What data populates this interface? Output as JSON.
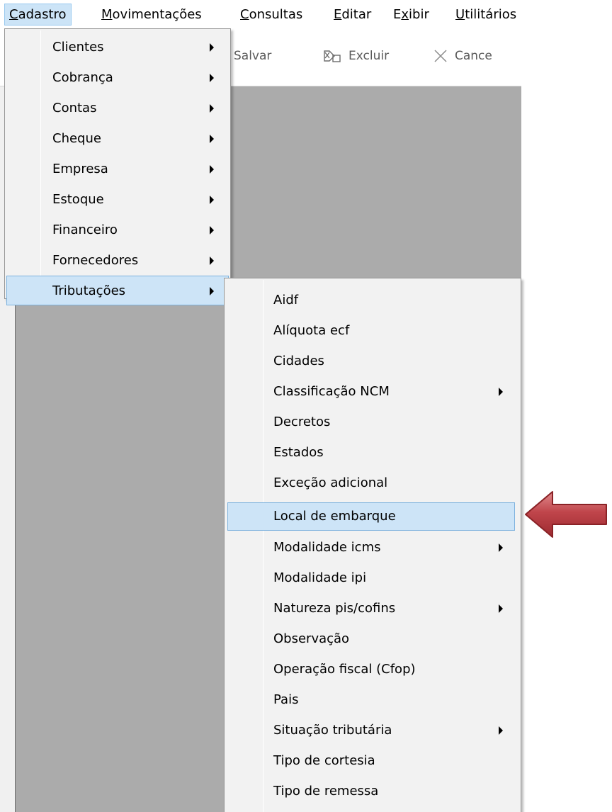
{
  "menubar": {
    "items": [
      {
        "accel": "C",
        "rest": "adastro"
      },
      {
        "accel": "M",
        "rest": "ovimentações"
      },
      {
        "accel": "C",
        "rest": "onsultas"
      },
      {
        "accel": "E",
        "rest": "ditar"
      },
      {
        "pre": "E",
        "accel": "x",
        "rest": "ibir"
      },
      {
        "accel": "U",
        "rest": "tilitários"
      }
    ]
  },
  "toolbar": {
    "save_label": "Salvar",
    "delete_label": "Excluir",
    "cancel_label": "Cance"
  },
  "cadastro_menu": {
    "items": [
      {
        "label": "Clientes"
      },
      {
        "label": "Cobrança"
      },
      {
        "label": "Contas"
      },
      {
        "label": "Cheque"
      },
      {
        "label": "Empresa"
      },
      {
        "label": "Estoque"
      },
      {
        "label": "Financeiro"
      },
      {
        "label": "Fornecedores"
      },
      {
        "label": "Tributações"
      }
    ]
  },
  "tributacoes_menu": {
    "items": [
      {
        "label": "Aidf"
      },
      {
        "label": "Alíquota ecf"
      },
      {
        "label": "Cidades"
      },
      {
        "label": "Classificação NCM"
      },
      {
        "label": "Decretos"
      },
      {
        "label": "Estados"
      },
      {
        "label": "Exceção adicional"
      },
      {
        "label": "Local de embarque"
      },
      {
        "label": "Modalidade icms"
      },
      {
        "label": "Modalidade ipi"
      },
      {
        "label": "Natureza pis/cofins"
      },
      {
        "label": "Observação"
      },
      {
        "label": "Operação fiscal (Cfop)"
      },
      {
        "label": "Pais"
      },
      {
        "label": "Situação tributária"
      },
      {
        "label": "Tipo de cortesia"
      },
      {
        "label": "Tipo de remessa"
      }
    ]
  },
  "colors": {
    "highlight_bg": "#cde4f7",
    "highlight_border": "#7db2de",
    "arrow_red": "#b5343a"
  },
  "icons": {
    "delete": "delete-icon",
    "cancel": "close-icon",
    "submenu": "chevron-right-icon",
    "annotation": "arrow-left-icon"
  }
}
